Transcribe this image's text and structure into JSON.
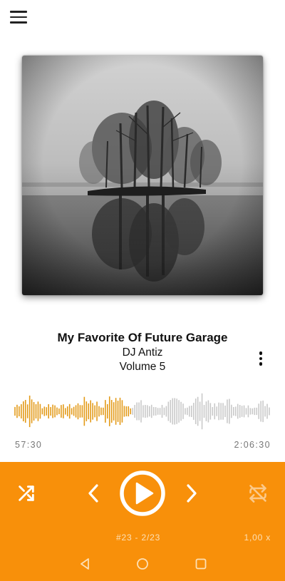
{
  "track": {
    "title": "My Favorite Of Future Garage",
    "artist": "DJ Antiz",
    "album": "Volume 5"
  },
  "playback": {
    "elapsed": "57:30",
    "duration": "2:06:30",
    "progress": 0.455,
    "queue_position": "#23  -  2/23",
    "speed": "1,00 x"
  },
  "colors": {
    "accent": "#f8900a",
    "waveform_played": "#e39a18",
    "waveform_unplayed": "#c9c9c9",
    "icon_on_accent": "#ffffff",
    "icon_disabled": "#fbc98a"
  },
  "icons": {
    "menu": "hamburger-icon",
    "more": "more-vertical-icon",
    "shuffle": "shuffle-icon",
    "previous": "chevron-left-icon",
    "play": "play-icon",
    "next": "chevron-right-icon",
    "repeat": "repeat-off-icon",
    "nav_back": "triangle-back-icon",
    "nav_home": "circle-home-icon",
    "nav_recents": "square-recents-icon"
  },
  "controls": {
    "repeat_enabled": false
  }
}
